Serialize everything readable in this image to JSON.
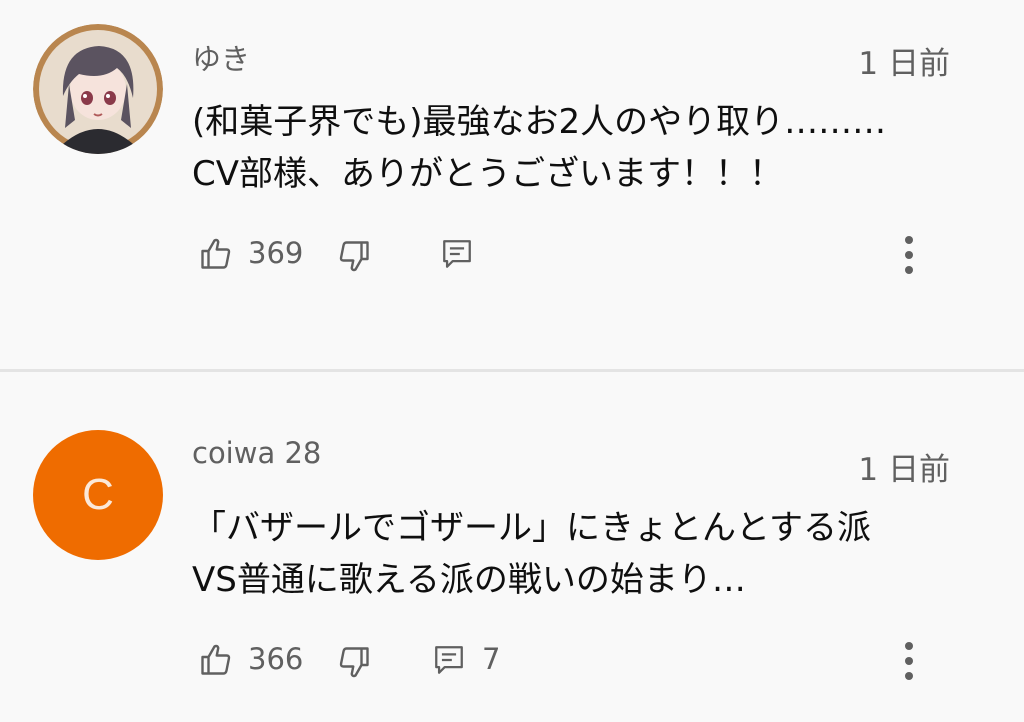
{
  "comments": [
    {
      "author": "ゆき",
      "time": "1 日前",
      "text_lines": [
        "(和菓子界でも)最強なお2人のやり取り………",
        "CV部様、ありがとうございます！！！"
      ],
      "likes": "369",
      "replies": ""
    },
    {
      "author": "coiwa 28",
      "avatar_letter": "C",
      "time": "1 日前",
      "text_lines": [
        "「バザールでゴザール」にきょとんとする派",
        "VS普通に歌える派の戦いの始まり…"
      ],
      "likes": "366",
      "replies": "7"
    }
  ],
  "colors": {
    "avatar_orange": "#ef6c00",
    "secondary_text": "#606060"
  },
  "icons": [
    "thumbs-up-icon",
    "thumbs-down-icon",
    "reply-icon",
    "more-vert-icon"
  ]
}
